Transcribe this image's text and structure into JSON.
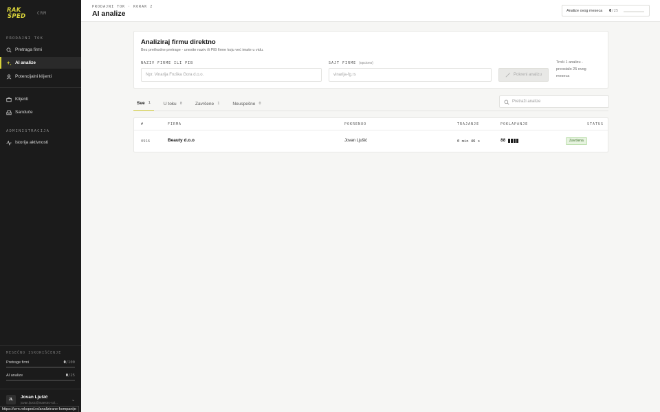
{
  "brand": {
    "logo_line1": "RAK",
    "logo_line2": "ŠPED",
    "app_tag": "CRM",
    "accent": "#d9d33a"
  },
  "sidebar": {
    "section_sales": "PRODAJNI TOK",
    "sales_items": [
      {
        "label": "Pretraga firmi",
        "icon": "search-icon"
      },
      {
        "label": "AI analize",
        "icon": "sparkle-icon"
      },
      {
        "label": "Potencijalni klijenti",
        "icon": "user-icon"
      }
    ],
    "other_items": [
      {
        "label": "Klijenti",
        "icon": "briefcase-icon"
      },
      {
        "label": "Sanduče",
        "icon": "inbox-icon"
      }
    ],
    "section_admin": "ADMINISTRACIJA",
    "admin_items": [
      {
        "label": "Istorija aktivnosti",
        "icon": "activity-icon"
      }
    ],
    "usage_title": "MESEČNO ISKORIŠĆENJE",
    "usage": [
      {
        "label": "Pretrage firmi",
        "used": "0",
        "limit": "/100",
        "fraction": 0
      },
      {
        "label": "AI analize",
        "used": "0",
        "limit": "/25",
        "fraction": 0
      }
    ],
    "user": {
      "initials": "JL",
      "name": "Jovan Ljušić",
      "email": "jovan.ljusic@maestro-sol..."
    }
  },
  "status_url": "https://crm.roksped.rs/analizirane-kompanije",
  "header": {
    "breadcrumb": "PRODAJNI TOK · KORAK 2",
    "title": "AI analize",
    "quota_label": "Analize ovog meseca",
    "quota_used": "0",
    "quota_limit": "/25",
    "quota_fraction": 0
  },
  "analyze_card": {
    "title": "Analiziraj firmu direktno",
    "subtitle": "Bez prethodne pretrage - unesite naziv ili PIB firme koju već imate u vidu.",
    "name_label": "NAZIV FIRME ILI PIB",
    "name_placeholder": "Npr. Vinarija Fruška Gora d.o.o.",
    "site_label": "SAJT FIRME",
    "site_optional": "(opciono)",
    "site_placeholder": "vinarija-fg.rs",
    "button_label": "Pokreni analizu",
    "credit_note": "Troši 1 analizu - preostalo 25 ovog meseca"
  },
  "tabs": [
    {
      "label": "Sve",
      "count": "1",
      "active": true
    },
    {
      "label": "U toku",
      "count": "0",
      "active": false
    },
    {
      "label": "Završene",
      "count": "1",
      "active": false
    },
    {
      "label": "Neuspešne",
      "count": "0",
      "active": false
    }
  ],
  "search": {
    "placeholder": "Pretraži analize"
  },
  "table": {
    "columns": [
      "#",
      "FIRMA",
      "POKRENUO",
      "TRAJANJE",
      "POKLAPANJE",
      "STATUS"
    ],
    "rows": [
      {
        "id": "0916",
        "firm": "Beauty d.o.o",
        "started_by": "Jovan Ljušić",
        "duration": "0 min 46 s",
        "match_score": "88",
        "match_pips": 4,
        "status": "Završena",
        "status_color": "#3b6e28"
      }
    ]
  }
}
